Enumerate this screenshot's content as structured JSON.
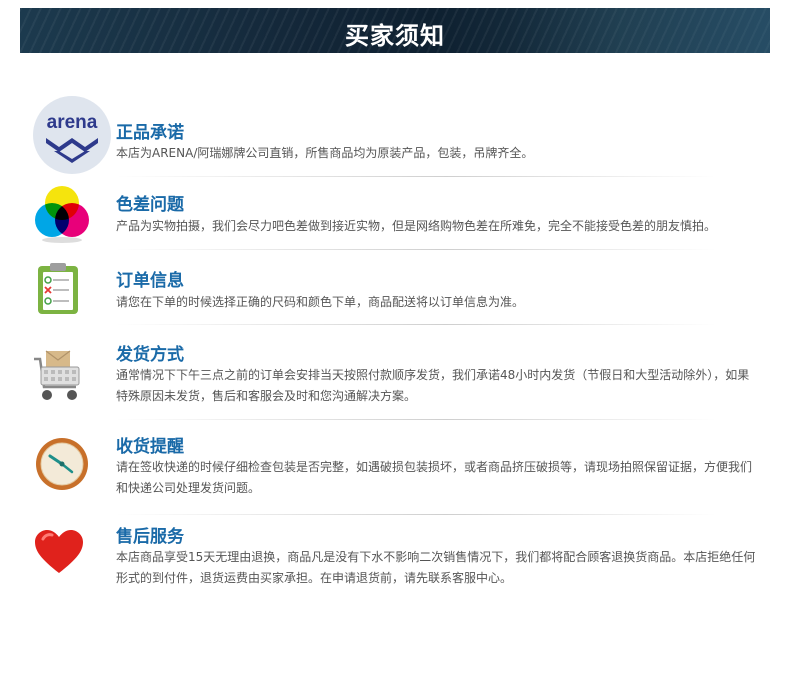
{
  "header": {
    "title": "买家须知"
  },
  "items": [
    {
      "icon": "arena-logo-icon",
      "logo_text": "arena",
      "title": "正品承诺",
      "desc": "本店为ARENA/阿瑞娜牌公司直销，所售商品均为原装产品，包装，吊牌齐全。"
    },
    {
      "icon": "color-wheel-icon",
      "title": "色差问题",
      "desc": "产品为实物拍摄，我们会尽力吧色差做到接近实物，但是网络购物色差在所难免，完全不能接受色差的朋友慎拍。"
    },
    {
      "icon": "clipboard-icon",
      "title": "订单信息",
      "desc": "请您在下单的时候选择正确的尺码和颜色下单，商品配送将以订单信息为准。"
    },
    {
      "icon": "shopping-cart-icon",
      "title": "发货方式",
      "desc": "通常情况下下午三点之前的订单会安排当天按照付款顺序发货，我们承诺48小时内发货（节假日和大型活动除外），如果特殊原因未发货，售后和客服会及时和您沟通解决方案。"
    },
    {
      "icon": "clock-icon",
      "title": "收货提醒",
      "desc": "请在签收快递的时候仔细检查包装是否完整，如遇破损包装损坏，或者商品挤压破损等，请现场拍照保留证据，方便我们和快递公司处理发货问题。"
    },
    {
      "icon": "heart-icon",
      "title": "售后服务",
      "desc": "本店商品享受15天无理由退换，商品凡是没有下水不影响二次销售情况下，我们都将配合顾客退换货商品。本店拒绝任何形式的到付件，退货运费由买家承担。在申请退货前，请先联系客服中心。"
    }
  ]
}
